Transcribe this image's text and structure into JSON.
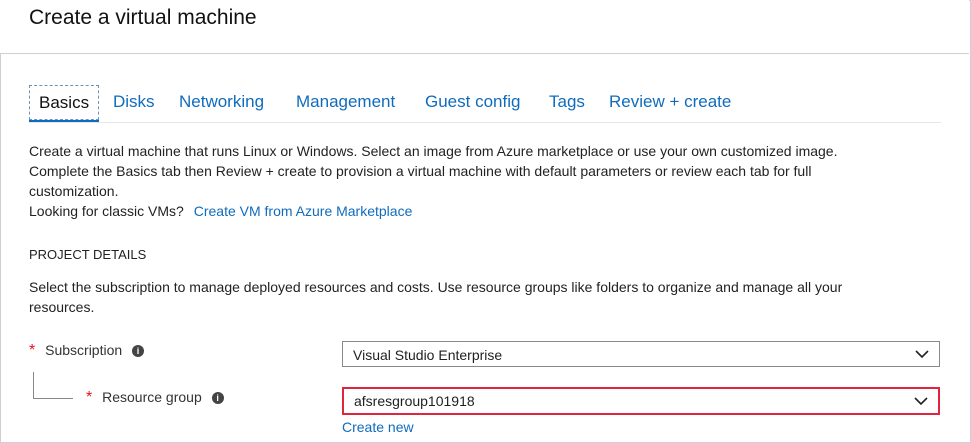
{
  "header": {
    "title": "Create a virtual machine"
  },
  "tabs": [
    {
      "label": "Basics",
      "active": true
    },
    {
      "label": "Disks",
      "active": false
    },
    {
      "label": "Networking",
      "active": false
    },
    {
      "label": "Management",
      "active": false
    },
    {
      "label": "Guest config",
      "active": false
    },
    {
      "label": "Tags",
      "active": false
    },
    {
      "label": "Review + create",
      "active": false
    }
  ],
  "intro": {
    "line1": "Create a virtual machine that runs Linux or Windows. Select an image from Azure marketplace or use your own customized image.",
    "line2": "Complete the Basics tab then Review + create to provision a virtual machine with default parameters or review each tab for full",
    "line3": "customization.",
    "classic_prefix": "Looking for classic VMs?",
    "classic_link": "Create VM from Azure Marketplace"
  },
  "project_details": {
    "title": "PROJECT DETAILS",
    "desc_line1": "Select the subscription to manage deployed resources and costs. Use resource groups like folders to organize and manage all your",
    "desc_line2": "resources."
  },
  "form": {
    "subscription": {
      "label": "Subscription",
      "value": "Visual Studio Enterprise"
    },
    "resource_group": {
      "label": "Resource group",
      "value": "afsresgroup101918",
      "create_new": "Create new"
    },
    "required_mark": "*",
    "info_glyph": "i"
  },
  "colors": {
    "accent": "#0f6cbd",
    "error": "#e0263d",
    "required": "#e81123"
  }
}
